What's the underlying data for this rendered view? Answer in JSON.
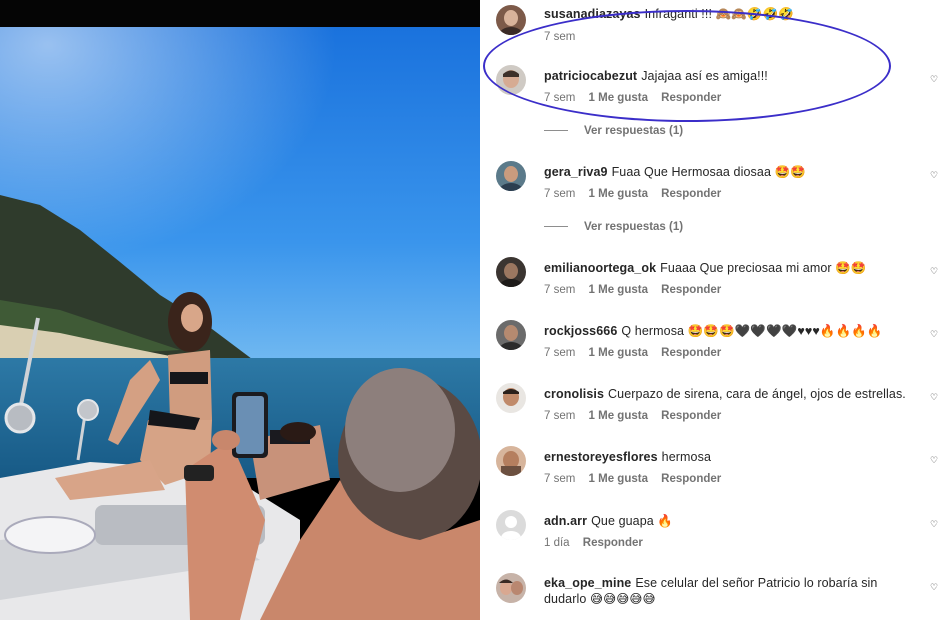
{
  "comments": [
    {
      "username": "susanadiazayas",
      "text": "Infraganti !!! 🙈🙈🤣🤣🤣",
      "time": "7 sem",
      "likes": "",
      "reply": ""
    },
    {
      "username": "patriciocabezut",
      "text": "Jajajaa así es amiga!!!",
      "time": "7 sem",
      "likes": "1 Me gusta",
      "reply": "Responder",
      "view_replies": "Ver respuestas (1)"
    },
    {
      "username": "gera_riva9",
      "text": "Fuaa Que Hermosaa diosaa 🤩🤩",
      "time": "7 sem",
      "likes": "1 Me gusta",
      "reply": "Responder",
      "view_replies": "Ver respuestas (1)"
    },
    {
      "username": "emilianoortega_ok",
      "text": "Fuaaa Que preciosaa mi amor 🤩🤩",
      "time": "7 sem",
      "likes": "1 Me gusta",
      "reply": "Responder"
    },
    {
      "username": "rockjoss666",
      "text": "Q hermosa 🤩🤩🤩🖤🖤🖤🖤♥♥♥🔥🔥🔥🔥",
      "time": "7 sem",
      "likes": "1 Me gusta",
      "reply": "Responder"
    },
    {
      "username": "cronolisis",
      "text": "Cuerpazo de sirena, cara de ángel, ojos de estrellas.",
      "time": "7 sem",
      "likes": "1 Me gusta",
      "reply": "Responder"
    },
    {
      "username": "ernestoreyesflores",
      "text": "hermosa",
      "time": "7 sem",
      "likes": "1 Me gusta",
      "reply": "Responder"
    },
    {
      "username": "adn.arr",
      "text": "Que guapa 🔥",
      "time": "1 día",
      "likes": "",
      "reply": "Responder"
    },
    {
      "username": "eka_ope_mine",
      "text": "Ese celular del señor Patricio lo robaría sin dudarlo 😅😅😅😅😅",
      "time": "",
      "likes": "",
      "reply": ""
    }
  ],
  "colors": {
    "highlight": "#3b2ec9",
    "sky": "#2a86e6",
    "sea": "#1d6fa8"
  }
}
